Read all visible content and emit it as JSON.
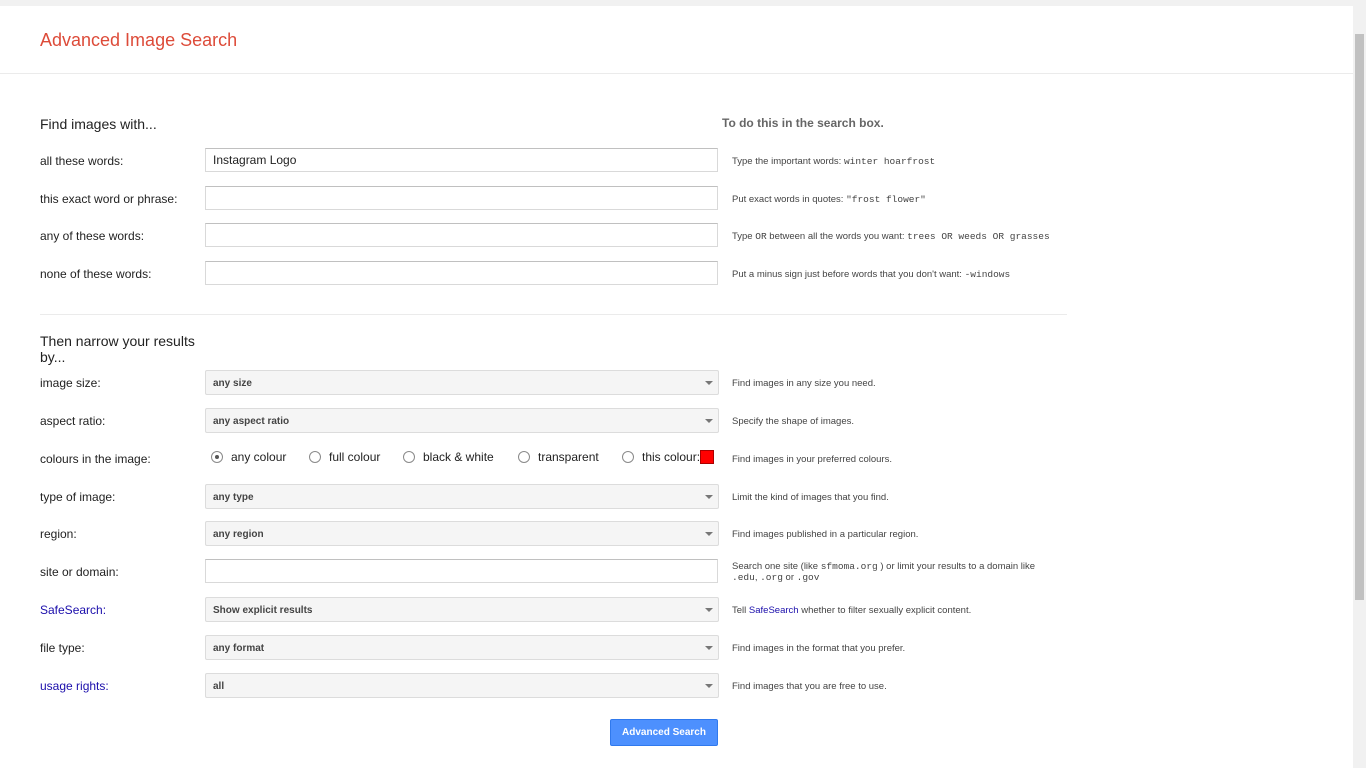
{
  "page": {
    "title": "Advanced Image Search"
  },
  "find": {
    "heading": "Find images with...",
    "hint_heading": "To do this in the search box.",
    "all_words": {
      "label": "all these words:",
      "value": "Instagram Logo",
      "hint_text": "Type the important words: ",
      "hint_example": "winter hoarfrost"
    },
    "exact_phrase": {
      "label": "this exact word or phrase:",
      "value": "",
      "hint_text": "Put exact words in quotes: ",
      "hint_example": "\"frost flower\""
    },
    "any_words": {
      "label": "any of these words:",
      "value": "",
      "hint_part1": "Type ",
      "hint_or": "OR",
      "hint_part2": " between all the words you want: ",
      "hint_example": "trees OR weeds OR grasses"
    },
    "none_words": {
      "label": "none of these words:",
      "value": "",
      "hint_text": "Put a minus sign just before words that you don't want: ",
      "hint_example": "-windows"
    }
  },
  "narrow": {
    "heading_line1": "Then narrow your results",
    "heading_line2": "by...",
    "image_size": {
      "label": "image size:",
      "value": "any size",
      "hint": "Find images in any size you need."
    },
    "aspect_ratio": {
      "label": "aspect ratio:",
      "value": "any aspect ratio",
      "hint": "Specify the shape of images."
    },
    "colours": {
      "label": "colours in the image:",
      "options": [
        "any colour",
        "full colour",
        "black & white",
        "transparent",
        "this colour:"
      ],
      "selected": "any colour",
      "swatch_color": "#ff0000",
      "hint": "Find images in your preferred colours."
    },
    "type_of_image": {
      "label": "type of image:",
      "value": "any type",
      "hint": "Limit the kind of images that you find."
    },
    "region": {
      "label": "region:",
      "value": "any region",
      "hint": "Find images published in a particular region."
    },
    "site": {
      "label": "site or domain:",
      "value": "",
      "hint_part1": "Search one site (like ",
      "hint_example1": "sfmoma.org",
      "hint_part2": " ) or limit your results to a domain like",
      "hint_example2": ".edu",
      "hint_sep1": ", ",
      "hint_example3": ".org",
      "hint_sep2": " or ",
      "hint_example4": ".gov"
    },
    "safesearch": {
      "label": "SafeSearch:",
      "value": "Show explicit results",
      "hint_part1": "Tell ",
      "hint_link": "SafeSearch",
      "hint_part2": " whether to filter sexually explicit content."
    },
    "file_type": {
      "label": "file type:",
      "value": "any format",
      "hint": "Find images in the format that you prefer."
    },
    "usage_rights": {
      "label": "usage rights:",
      "value": "all",
      "hint": "Find images that you are free to use."
    }
  },
  "submit": {
    "label": "Advanced Search"
  },
  "colors": {
    "title_red": "#dd4b39",
    "link_blue": "#1a0dab",
    "button_blue": "#4d90fe"
  }
}
